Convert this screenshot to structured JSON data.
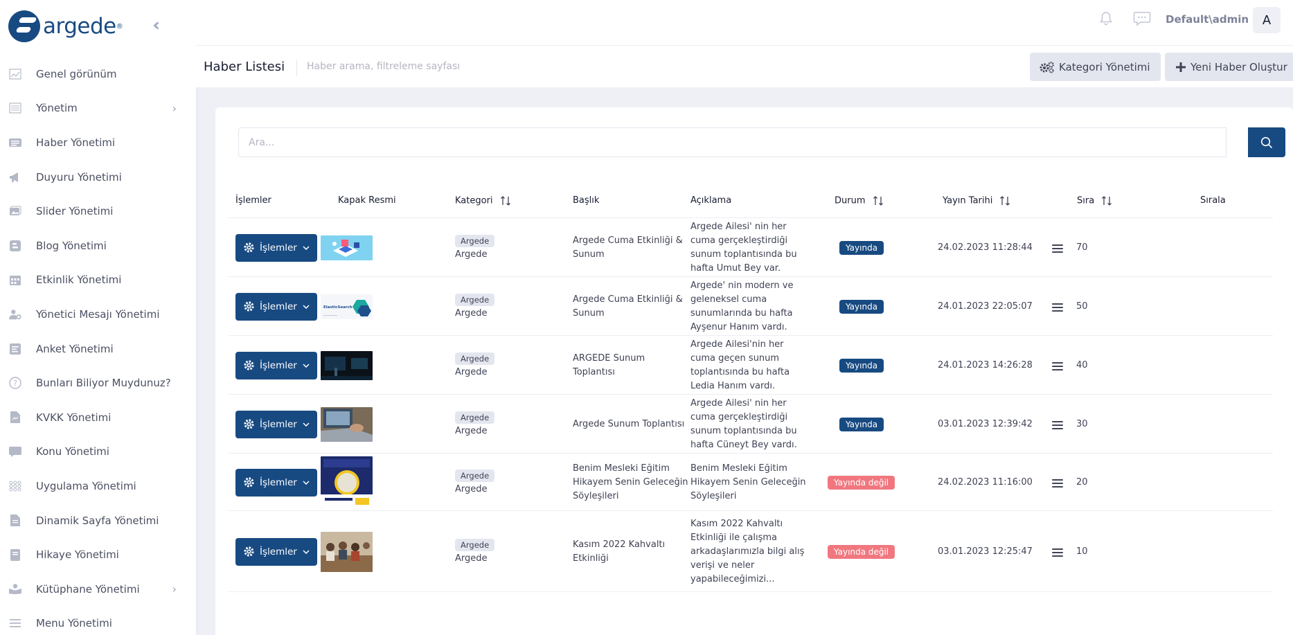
{
  "brand": {
    "name": "argede",
    "reg": "®"
  },
  "sidebar": {
    "items": [
      {
        "label": "Genel görünüm",
        "icon": "chart-icon",
        "chevron": false
      },
      {
        "label": "Yönetim",
        "icon": "settings-panel-icon",
        "chevron": true
      },
      {
        "label": "Haber Yönetimi",
        "icon": "news-icon",
        "chevron": false
      },
      {
        "label": "Duyuru Yönetimi",
        "icon": "megaphone-icon",
        "chevron": false
      },
      {
        "label": "Slider Yönetimi",
        "icon": "images-icon",
        "chevron": false
      },
      {
        "label": "Blog Yönetimi",
        "icon": "blogger-icon",
        "chevron": false
      },
      {
        "label": "Etkinlik Yönetimi",
        "icon": "calendar-icon",
        "chevron": false
      },
      {
        "label": "Yönetici Mesajı Yönetimi",
        "icon": "user-gear-icon",
        "chevron": false
      },
      {
        "label": "Anket Yönetimi",
        "icon": "poll-icon",
        "chevron": false
      },
      {
        "label": "Bunları Biliyor Muydunuz?",
        "icon": "question-icon",
        "chevron": false
      },
      {
        "label": "KVKK Yönetimi",
        "icon": "document-icon",
        "chevron": false
      },
      {
        "label": "Konu Yönetimi",
        "icon": "comment-icon",
        "chevron": false
      },
      {
        "label": "Uygulama Yönetimi",
        "icon": "apps-grid-icon",
        "chevron": false
      },
      {
        "label": "Dinamik Sayfa Yönetimi",
        "icon": "page-icon",
        "chevron": false
      },
      {
        "label": "Hikaye Yönetimi",
        "icon": "book-icon",
        "chevron": false
      },
      {
        "label": "Kütüphane Yönetimi",
        "icon": "reader-icon",
        "chevron": true
      },
      {
        "label": "Menu Yönetimi",
        "icon": "menu-lines-icon",
        "chevron": false
      }
    ]
  },
  "topbar": {
    "user": "Default\\admin",
    "avatar_letter": "A"
  },
  "subheader": {
    "title": "Haber Listesi",
    "subtitle": "Haber arama, filtreleme sayfası",
    "category_button": "Kategori Yönetimi",
    "new_button": "Yeni Haber Oluştur"
  },
  "search": {
    "placeholder": "Ara..."
  },
  "table": {
    "headers": {
      "actions": "İşlemler",
      "cover": "Kapak Resmi",
      "category": "Kategori",
      "title": "Başlık",
      "description": "Açıklama",
      "status": "Durum",
      "date": "Yayın Tarihi",
      "order": "Sıra",
      "sort": "Sırala"
    },
    "action_label": "İşlemler",
    "rows": [
      {
        "category_badge": "Argede",
        "category": "Argede",
        "title": [
          "Argede Cuma Etkinliği &",
          "Sunum"
        ],
        "description": [
          "Argede Ailesi' nin her",
          "cuma gerçekleştirdiği",
          "sunum toplantısında bu",
          "hafta Umut Bey var."
        ],
        "status": "Yayında",
        "status_on": true,
        "date": "24.02.2023 11:28:44",
        "order": "70",
        "thumb": "iso-illustration"
      },
      {
        "category_badge": "Argede",
        "category": "Argede",
        "title": [
          "Argede Cuma Etkinliği &",
          "Sunum"
        ],
        "description": [
          "Argede' nin modern ve",
          "geleneksel cuma",
          "sunumlarında bu hafta",
          "Ayşenur Hanım vardı."
        ],
        "status": "Yayında",
        "status_on": true,
        "date": "24.01.2023 22:05:07",
        "order": "50",
        "thumb": "elasticsearch-slide",
        "thumb_text": "ElasticSearch"
      },
      {
        "category_badge": "Argede",
        "category": "Argede",
        "title": [
          "ARGEDE Sunum",
          "Toplantısı"
        ],
        "description": [
          "Argede Ailesi'nin her",
          "cuma geçen sunum",
          "toplantısında bu hafta",
          "Ledia Hanım vardı."
        ],
        "status": "Yayında",
        "status_on": true,
        "date": "24.01.2023 14:26:28",
        "order": "40",
        "thumb": "dark-photo"
      },
      {
        "category_badge": "Argede",
        "category": "Argede",
        "title": [
          "Argede Sunum Toplantısı"
        ],
        "description": [
          "Argede Ailesi' nin her",
          "cuma gerçekleştirdiği",
          "sunum toplantısında bu",
          "hafta Cüneyt Bey vardı."
        ],
        "status": "Yayında",
        "status_on": true,
        "date": "03.01.2023 12:39:42",
        "order": "30",
        "thumb": "laptop-photo"
      },
      {
        "category_badge": "Argede",
        "category": "Argede",
        "title": [
          "Benim Mesleki Eğitim",
          "Hikayem Senin Geleceğin",
          "Söyleşileri"
        ],
        "description": [
          "Benim Mesleki Eğitim",
          "Hikayem Senin Geleceğin",
          "Söyleşileri"
        ],
        "status": "Yayında değil",
        "status_on": false,
        "date": "24.02.2023 11:16:00",
        "order": "20",
        "thumb": "poster"
      },
      {
        "category_badge": "Argede",
        "category": "Argede",
        "title": [
          "Kasım 2022 Kahvaltı",
          "Etkinliği"
        ],
        "description": [
          "Kasım 2022 Kahvaltı",
          "Etkinliği ile çalışma",
          "arkadaşlarımızla bilgi alış",
          "verişi ve neler",
          "yapabileceğimizi..."
        ],
        "status": "Yayında değil",
        "status_on": false,
        "date": "03.01.2023 12:25:47",
        "order": "10",
        "thumb": "group-photo"
      }
    ]
  },
  "colors": {
    "primary": "#184a82",
    "inactive": "#f1777f",
    "badge": "#e4e6ef"
  }
}
